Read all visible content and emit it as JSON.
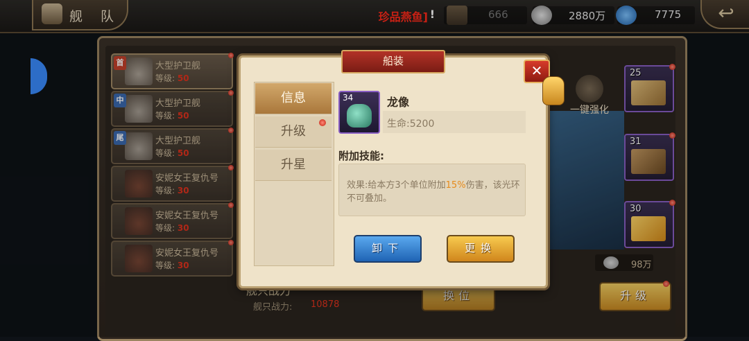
{
  "header": {
    "title": "舰 队",
    "ticker": "珍品燕鱼]",
    "ticker_tail": "!",
    "resources": [
      {
        "icon": "crate-icon",
        "value": "666"
      },
      {
        "icon": "silver-coin-icon",
        "value": "2880万"
      },
      {
        "icon": "gem-icon",
        "value": "7775"
      }
    ]
  },
  "fleet": {
    "level_label": "等级:",
    "ships": [
      {
        "badge": "首",
        "name": "大型护卫舰",
        "level": "50",
        "badge_color": "#c4412b"
      },
      {
        "badge": "中",
        "name": "大型护卫舰",
        "level": "50",
        "badge_color": "#3a6ab0"
      },
      {
        "badge": "尾",
        "name": "大型护卫舰",
        "level": "50",
        "badge_color": "#3a6ab0"
      },
      {
        "badge": "",
        "name": "安妮女王复仇号",
        "level": "30",
        "badge_color": ""
      },
      {
        "badge": "",
        "name": "安妮女王复仇号",
        "level": "30",
        "badge_color": ""
      },
      {
        "badge": "",
        "name": "安妮女王复仇号",
        "level": "30",
        "badge_color": ""
      }
    ],
    "power_label": "舰只战力",
    "power_sub_label": "舰只战力:",
    "power_value": "10878"
  },
  "right": {
    "auto_upgrade_label": "一键强化",
    "slots": [
      {
        "level": "25",
        "art": "wood-plank-icon"
      },
      {
        "level": "31",
        "art": "wooden-crate-icon"
      },
      {
        "level": "30",
        "art": "golden-sail-icon"
      }
    ],
    "cost_value": "98万",
    "swap_label": "换位",
    "upgrade_label": "升级"
  },
  "dialog": {
    "title": "船装",
    "tabs": [
      "信息",
      "升级",
      "升星"
    ],
    "item": {
      "level": "34",
      "name": "龙像",
      "stat": "生命:5200"
    },
    "skill_title": "附加技能:",
    "skill_text_before": "效果:给本方3个单位附加",
    "skill_highlight": "15%",
    "skill_text_after": "伤害，该光环不可叠加。",
    "unequip_label": "卸下",
    "replace_label": "更换"
  }
}
